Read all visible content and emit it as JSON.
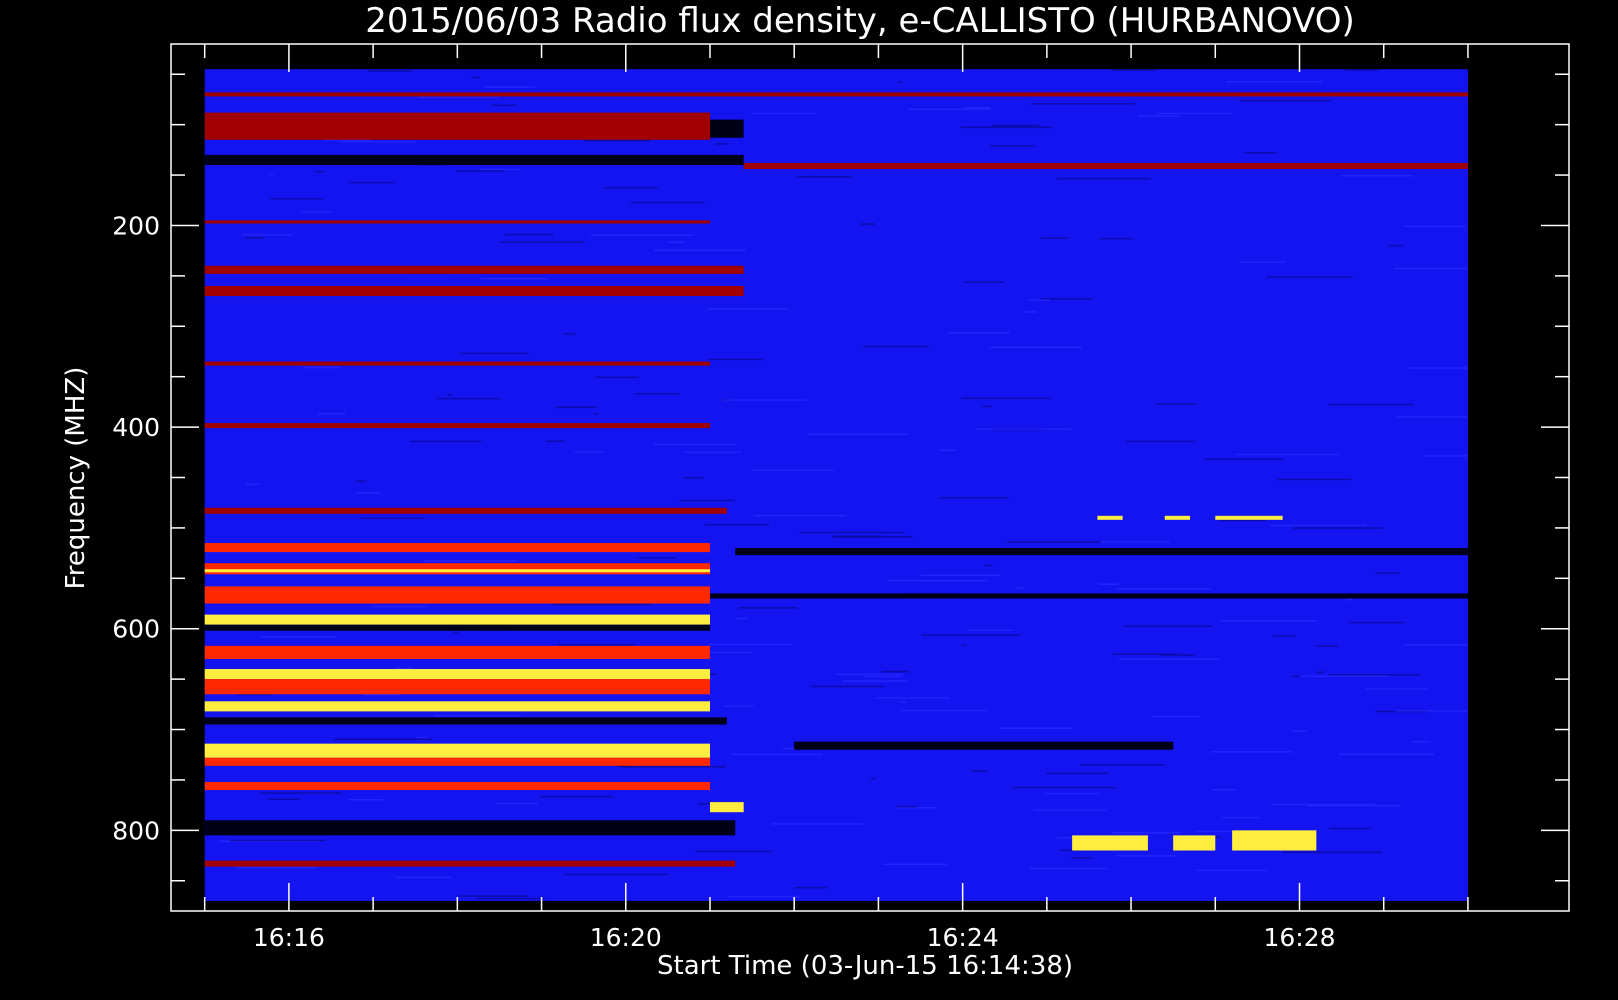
{
  "chart_data": {
    "type": "heatmap",
    "title": "2015/06/03  Radio flux density, e-CALLISTO (HURBANOVO)",
    "xlabel": "Start Time (03-Jun-15 16:14:38)",
    "ylabel": "Frequency (MHZ)",
    "x_tick_labels": [
      "16:16",
      "16:20",
      "16:24",
      "16:28"
    ],
    "x_tick_values_min": [
      16,
      20,
      24,
      28
    ],
    "y_tick_labels": [
      "200",
      "400",
      "600",
      "800"
    ],
    "y_tick_values": [
      200,
      400,
      600,
      800
    ],
    "xlim_min": [
      14.6,
      31.2
    ],
    "ylim": [
      880,
      20
    ],
    "y_inverted": true,
    "data_xlim_min": [
      15.0,
      30.0
    ],
    "data_ylim": [
      45,
      870
    ],
    "grid": false,
    "colors": {
      "background": "#000000",
      "base": "#1414f0",
      "low": "#000018",
      "mid": "#a00000",
      "high": "#ff2800",
      "peak": "#ffee40",
      "max": "#ffffff"
    },
    "bands": [
      {
        "f0": 68,
        "f1": 72,
        "t0": 15.0,
        "t1": 30.0,
        "level": "mid"
      },
      {
        "f0": 88,
        "f1": 115,
        "t0": 15.0,
        "t1": 21.0,
        "level": "mid"
      },
      {
        "f0": 95,
        "f1": 113,
        "t0": 21.0,
        "t1": 21.4,
        "level": "low"
      },
      {
        "f0": 130,
        "f1": 140,
        "t0": 15.0,
        "t1": 21.4,
        "level": "low"
      },
      {
        "f0": 138,
        "f1": 144,
        "t0": 21.4,
        "t1": 30.0,
        "level": "mid"
      },
      {
        "f0": 195,
        "f1": 198,
        "t0": 15.0,
        "t1": 21.0,
        "level": "mid"
      },
      {
        "f0": 240,
        "f1": 248,
        "t0": 15.0,
        "t1": 21.4,
        "level": "mid"
      },
      {
        "f0": 260,
        "f1": 270,
        "t0": 15.0,
        "t1": 21.4,
        "level": "mid"
      },
      {
        "f0": 335,
        "f1": 339,
        "t0": 15.0,
        "t1": 21.0,
        "level": "mid"
      },
      {
        "f0": 396,
        "f1": 401,
        "t0": 15.0,
        "t1": 21.0,
        "level": "mid"
      },
      {
        "f0": 480,
        "f1": 486,
        "t0": 15.0,
        "t1": 21.2,
        "level": "mid"
      },
      {
        "f0": 515,
        "f1": 524,
        "t0": 15.0,
        "t1": 21.0,
        "level": "high"
      },
      {
        "f0": 520,
        "f1": 527,
        "t0": 21.3,
        "t1": 30.0,
        "level": "low"
      },
      {
        "f0": 535,
        "f1": 546,
        "t0": 15.0,
        "t1": 21.0,
        "level": "high"
      },
      {
        "f0": 541,
        "f1": 544,
        "t0": 15.0,
        "t1": 21.0,
        "level": "peak"
      },
      {
        "f0": 558,
        "f1": 575,
        "t0": 15.0,
        "t1": 21.0,
        "level": "high"
      },
      {
        "f0": 565,
        "f1": 570,
        "t0": 21.0,
        "t1": 30.0,
        "level": "low"
      },
      {
        "f0": 586,
        "f1": 596,
        "t0": 15.0,
        "t1": 21.0,
        "level": "peak"
      },
      {
        "f0": 596,
        "f1": 602,
        "t0": 15.0,
        "t1": 21.0,
        "level": "low"
      },
      {
        "f0": 617,
        "f1": 630,
        "t0": 15.0,
        "t1": 21.0,
        "level": "high"
      },
      {
        "f0": 640,
        "f1": 650,
        "t0": 15.0,
        "t1": 21.0,
        "level": "peak"
      },
      {
        "f0": 650,
        "f1": 665,
        "t0": 15.0,
        "t1": 21.0,
        "level": "high"
      },
      {
        "f0": 672,
        "f1": 682,
        "t0": 15.0,
        "t1": 21.0,
        "level": "peak"
      },
      {
        "f0": 688,
        "f1": 695,
        "t0": 15.0,
        "t1": 21.2,
        "level": "low"
      },
      {
        "f0": 714,
        "f1": 728,
        "t0": 15.0,
        "t1": 21.0,
        "level": "peak"
      },
      {
        "f0": 728,
        "f1": 736,
        "t0": 15.0,
        "t1": 21.0,
        "level": "high"
      },
      {
        "f0": 712,
        "f1": 720,
        "t0": 22.0,
        "t1": 26.5,
        "level": "low"
      },
      {
        "f0": 752,
        "f1": 760,
        "t0": 15.0,
        "t1": 21.0,
        "level": "high"
      },
      {
        "f0": 772,
        "f1": 782,
        "t0": 21.0,
        "t1": 21.4,
        "level": "peak"
      },
      {
        "f0": 790,
        "f1": 805,
        "t0": 15.0,
        "t1": 21.3,
        "level": "low"
      },
      {
        "f0": 830,
        "f1": 836,
        "t0": 15.0,
        "t1": 21.3,
        "level": "mid"
      },
      {
        "f0": 805,
        "f1": 820,
        "t0": 25.3,
        "t1": 26.2,
        "level": "peak"
      },
      {
        "f0": 805,
        "f1": 820,
        "t0": 26.5,
        "t1": 27.0,
        "level": "peak"
      },
      {
        "f0": 800,
        "f1": 820,
        "t0": 27.2,
        "t1": 28.2,
        "level": "peak"
      },
      {
        "f0": 488,
        "f1": 492,
        "t0": 25.6,
        "t1": 25.9,
        "level": "peak"
      },
      {
        "f0": 488,
        "f1": 492,
        "t0": 26.4,
        "t1": 26.7,
        "level": "peak"
      },
      {
        "f0": 488,
        "f1": 492,
        "t0": 27.0,
        "t1": 27.8,
        "level": "peak"
      }
    ]
  }
}
